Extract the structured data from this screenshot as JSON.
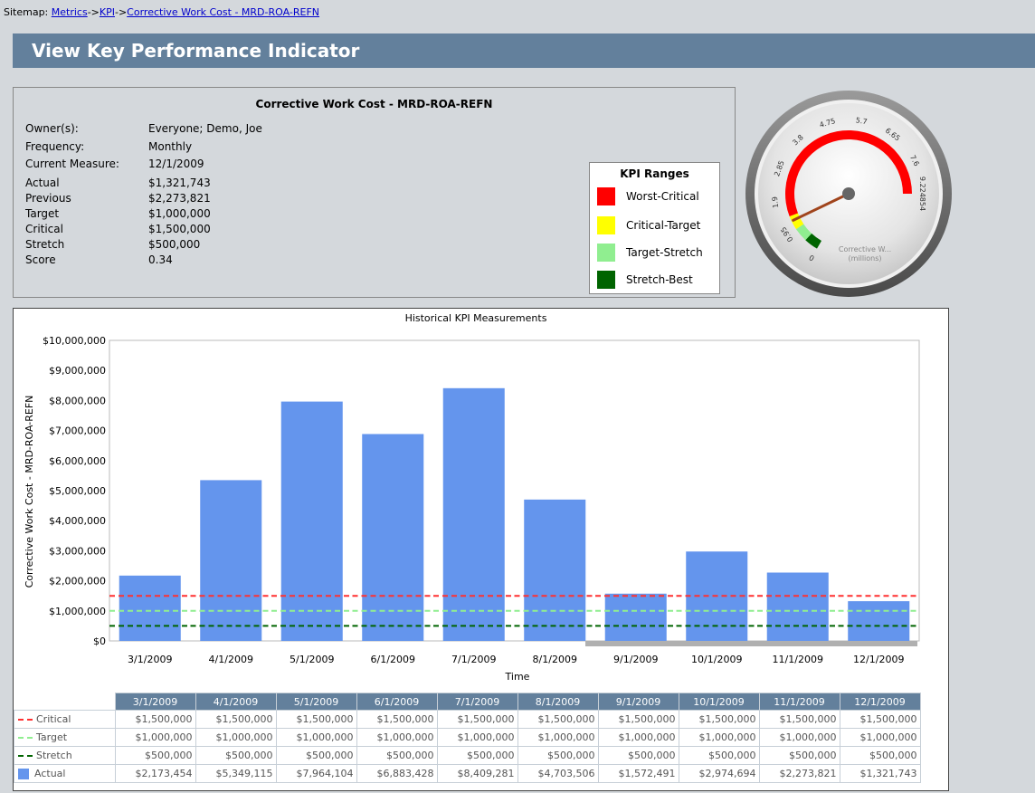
{
  "sitemap": {
    "prefix": "Sitemap: ",
    "links": [
      "Metrics",
      "KPI",
      "Corrective Work Cost - MRD-ROA-REFN"
    ],
    "separator": "->"
  },
  "page_title": "View Key Performance Indicator",
  "kpi": {
    "name": "Corrective Work Cost - MRD-ROA-REFN",
    "fields": [
      {
        "label": "Owner(s):",
        "value": "Everyone; Demo, Joe"
      },
      {
        "label": "Frequency:",
        "value": "Monthly"
      },
      {
        "label": "Current Measure:",
        "value": "12/1/2009"
      },
      {
        "label": "Actual",
        "value": "$1,321,743"
      },
      {
        "label": "Previous",
        "value": "$2,273,821"
      },
      {
        "label": "Target",
        "value": "$1,000,000"
      },
      {
        "label": "Critical",
        "value": "$1,500,000"
      },
      {
        "label": "Stretch",
        "value": "$500,000"
      },
      {
        "label": "Score",
        "value": "0.34"
      }
    ]
  },
  "kpi_ranges": {
    "title": "KPI Ranges",
    "items": [
      {
        "label": "Worst-Critical",
        "color": "#ff0000"
      },
      {
        "label": "Critical-Target",
        "color": "#ffff00"
      },
      {
        "label": "Target-Stretch",
        "color": "#90ee90"
      },
      {
        "label": "Stretch-Best",
        "color": "#006400"
      }
    ]
  },
  "gauge": {
    "ticks": [
      "0",
      "0.95",
      "1.9",
      "2.85",
      "3.8",
      "4.75",
      "5.7",
      "6.65",
      "7.6",
      "9.224854"
    ],
    "label_line1": "Corrective W...",
    "label_line2": "(millions)",
    "value": 1.321743,
    "max": 9.224854
  },
  "chart_data": {
    "type": "bar",
    "title": "Historical KPI Measurements",
    "xlabel": "Time",
    "ylabel": "Corrective Work Cost - MRD-ROA-REFN",
    "ylim": [
      0,
      10000000
    ],
    "yticks": [
      "$0",
      "$1,000,000",
      "$2,000,000",
      "$3,000,000",
      "$4,000,000",
      "$5,000,000",
      "$6,000,000",
      "$7,000,000",
      "$8,000,000",
      "$9,000,000",
      "$10,000,000"
    ],
    "categories": [
      "3/1/2009",
      "4/1/2009",
      "5/1/2009",
      "6/1/2009",
      "7/1/2009",
      "8/1/2009",
      "9/1/2009",
      "10/1/2009",
      "11/1/2009",
      "12/1/2009"
    ],
    "series": [
      {
        "name": "Critical",
        "type": "line",
        "color": "#ff3030",
        "values": [
          1500000,
          1500000,
          1500000,
          1500000,
          1500000,
          1500000,
          1500000,
          1500000,
          1500000,
          1500000
        ],
        "labels": [
          "$1,500,000",
          "$1,500,000",
          "$1,500,000",
          "$1,500,000",
          "$1,500,000",
          "$1,500,000",
          "$1,500,000",
          "$1,500,000",
          "$1,500,000",
          "$1,500,000"
        ]
      },
      {
        "name": "Target",
        "type": "line",
        "color": "#90ee90",
        "values": [
          1000000,
          1000000,
          1000000,
          1000000,
          1000000,
          1000000,
          1000000,
          1000000,
          1000000,
          1000000
        ],
        "labels": [
          "$1,000,000",
          "$1,000,000",
          "$1,000,000",
          "$1,000,000",
          "$1,000,000",
          "$1,000,000",
          "$1,000,000",
          "$1,000,000",
          "$1,000,000",
          "$1,000,000"
        ]
      },
      {
        "name": "Stretch",
        "type": "line",
        "color": "#006400",
        "values": [
          500000,
          500000,
          500000,
          500000,
          500000,
          500000,
          500000,
          500000,
          500000,
          500000
        ],
        "labels": [
          "$500,000",
          "$500,000",
          "$500,000",
          "$500,000",
          "$500,000",
          "$500,000",
          "$500,000",
          "$500,000",
          "$500,000",
          "$500,000"
        ]
      },
      {
        "name": "Actual",
        "type": "bar",
        "color": "#6495ed",
        "values": [
          2173454,
          5349115,
          7964104,
          6883428,
          8409281,
          4703506,
          1572491,
          2974694,
          2273821,
          1321743
        ],
        "labels": [
          "$2,173,454",
          "$5,349,115",
          "$7,964,104",
          "$6,883,428",
          "$8,409,281",
          "$4,703,506",
          "$1,572,491",
          "$2,974,694",
          "$2,273,821",
          "$1,321,743"
        ]
      }
    ]
  }
}
